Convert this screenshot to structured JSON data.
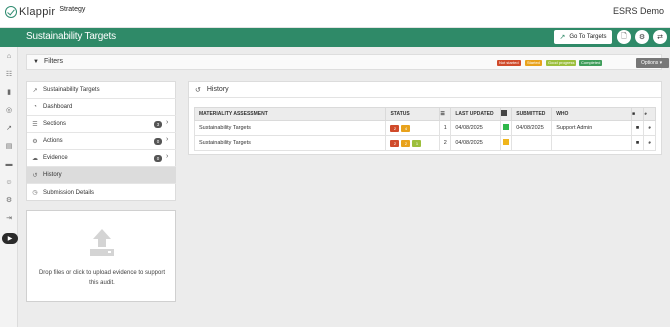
{
  "app": {
    "logo_text": "Klappir",
    "logo_sub": "Strategy",
    "title": "ESRS Demo"
  },
  "banner": {
    "title": "Sustainability Targets",
    "go_button": "Go To Targets"
  },
  "filters": {
    "label": "Filters",
    "badges": [
      {
        "label": "Not started",
        "color": "#d04a2a"
      },
      {
        "label": "Started",
        "color": "#e8a21c"
      },
      {
        "label": "Good progress",
        "color": "#9cbf3c"
      },
      {
        "label": "Completed",
        "color": "#3f9d5a"
      }
    ],
    "options_label": "Options",
    "add_label": "+"
  },
  "nav": {
    "items": [
      {
        "label": "Sustainability Targets",
        "icon": "chart-icon"
      },
      {
        "label": "Dashboard",
        "icon": "dashboard-icon"
      },
      {
        "label": "Sections",
        "icon": "list-icon",
        "count": "3"
      },
      {
        "label": "Actions",
        "icon": "gear-icon",
        "count": "0"
      },
      {
        "label": "Evidence",
        "icon": "cloud-icon",
        "count": "0"
      },
      {
        "label": "History",
        "icon": "history-icon"
      },
      {
        "label": "Submission Details",
        "icon": "clock-icon"
      }
    ]
  },
  "upload": {
    "text": "Drop files or click to upload evidence to support this audit."
  },
  "history": {
    "title": "History",
    "columns": [
      "MATERIALITY ASSESSMENT",
      "STATUS",
      "",
      "LAST UPDATED",
      "",
      "SUBMITTED",
      "WHO",
      "",
      ""
    ],
    "rows": [
      {
        "name": "Sustainability Targets",
        "status": [
          "2",
          "4"
        ],
        "count": "1",
        "updated": "04/08/2025",
        "flag_color": "#2eb84a",
        "submitted": "04/08/2025",
        "who": "Support Admin"
      },
      {
        "name": "Sustainability Targets",
        "status": [
          "2",
          "2",
          "1"
        ],
        "count": "2",
        "updated": "04/08/2025",
        "flag_color": "#f0b51c",
        "submitted": "",
        "who": ""
      }
    ]
  },
  "colors": {
    "brand_green": "#2f8a68",
    "not_started": "#d04a2a",
    "started": "#e8a21c",
    "good_progress": "#9cbf3c"
  }
}
